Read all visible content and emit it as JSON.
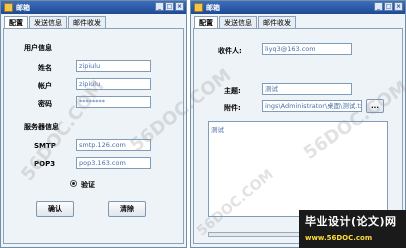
{
  "app": {
    "title": "邮箱"
  },
  "window_controls": {
    "minimize": "_",
    "maximize": "□",
    "close": "×"
  },
  "tabs": [
    "配置",
    "发送信息",
    "邮件收发"
  ],
  "config": {
    "user_section": "用户信息",
    "name_label": "姓名",
    "name_value": "zipiulu",
    "account_label": "帐户",
    "account_value": "zipiulu",
    "password_label": "密码",
    "password_value": "********",
    "server_section": "服务器信息",
    "smtp_label": "SMTP",
    "smtp_value": "smtp.126.com",
    "pop3_label": "POP3",
    "pop3_value": "pop3.163.com",
    "verify_label": "验证",
    "confirm_button": "确认",
    "cancel_button": "清除"
  },
  "send": {
    "recipient_label": "收件人:",
    "recipient_value": "liyq3@163.com",
    "subject_label": "主题:",
    "subject_value": "测试",
    "attachment_label": "附件:",
    "attachment_value": "ings\\Administrator\\桌面\\测试.txt",
    "browse_button": "...",
    "body_value": "测试"
  },
  "watermarks": [
    "56DOC.COM",
    "56DOC.COM",
    "56DOC.COM",
    "56DOC.COM"
  ],
  "banner": {
    "line1": "毕业设计(论文)网",
    "line2": "www.56DOC.com"
  }
}
